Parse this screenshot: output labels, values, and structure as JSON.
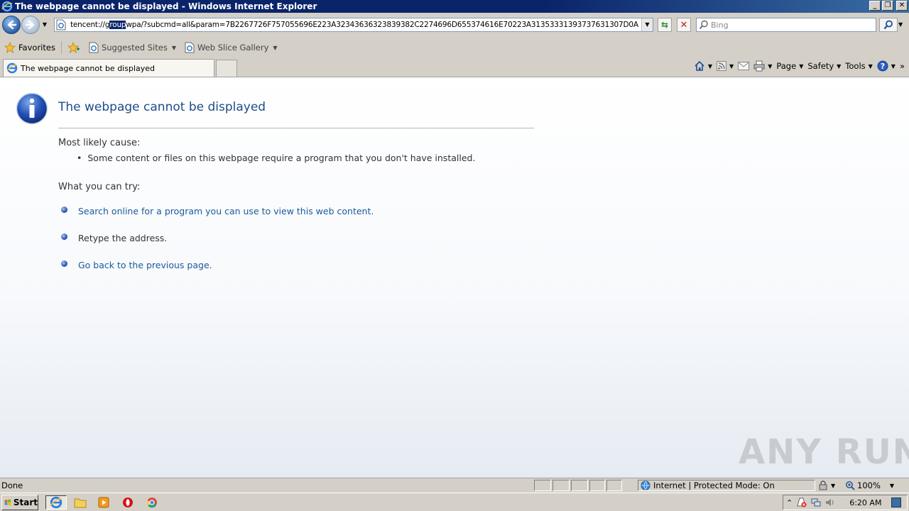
{
  "window": {
    "title": "The webpage cannot be displayed - Windows Internet Explorer",
    "minimize": "_",
    "restore": "❐",
    "close": "✕"
  },
  "address": {
    "prefix": "tencent://g",
    "selected": "roup",
    "suffix": "wpa/?subcmd=all&param=7B2267726F757055696E223A32343636323839382C2274696D655374616E70223A31353331393737631307D0A"
  },
  "search": {
    "placeholder": "Bing"
  },
  "favorites": {
    "favorites_label": "Favorites",
    "suggested_label": "Suggested Sites",
    "webslice_label": "Web Slice Gallery"
  },
  "tab": {
    "label": "The webpage cannot be displayed"
  },
  "commands": {
    "page": "Page",
    "safety": "Safety",
    "tools": "Tools"
  },
  "content": {
    "title": "The webpage cannot be displayed",
    "cause_label": "Most likely cause:",
    "cause_item": "Some content or files on this webpage require a program that you don't have installed.",
    "try_label": "What you can try:",
    "try_items": [
      "Search online for a program you can use to view this web content.",
      "Retype the address.",
      "Go back to the previous page."
    ],
    "watermark": "ANY RUN"
  },
  "status": {
    "text": "Done",
    "zone": "Internet | Protected Mode: On",
    "zoom": "100%"
  },
  "taskbar": {
    "start": "Start",
    "clock": "6:20 AM"
  },
  "colors": {
    "title_blue": "#1f4c8a",
    "link_blue": "#1a5a9c",
    "titlebar": "#0a246a"
  }
}
